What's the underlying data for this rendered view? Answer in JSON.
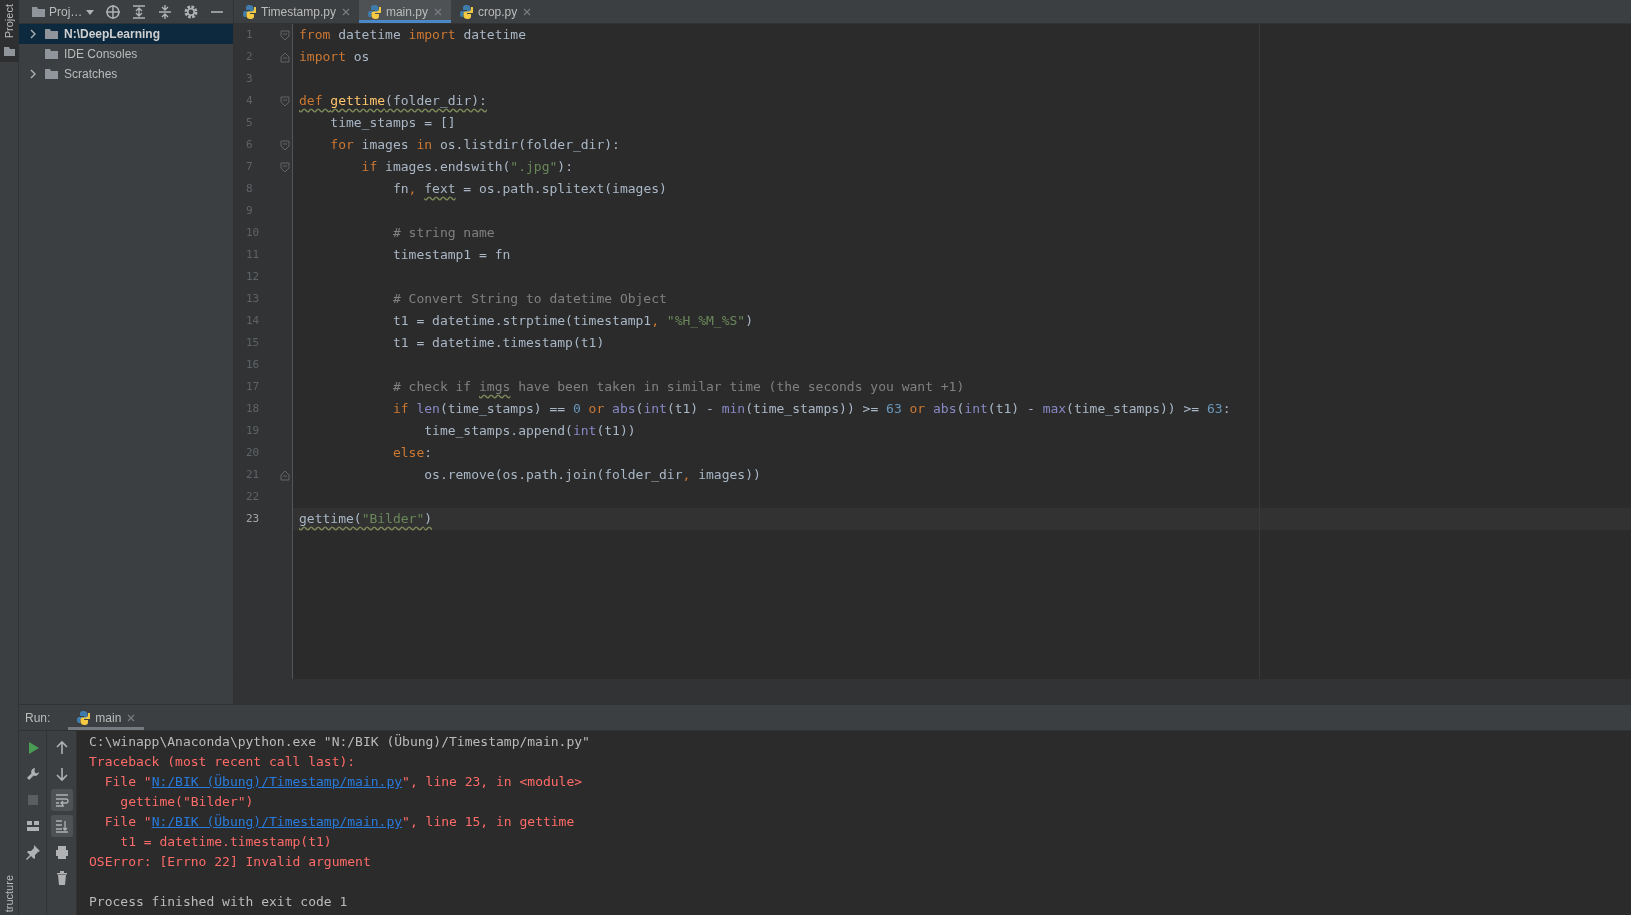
{
  "side_stripe": {
    "top_label": "Project",
    "bottom_label": "tructure"
  },
  "project_toolbar": {
    "title": "Proj…"
  },
  "project_tree": [
    {
      "label": "N:\\DeepLearning",
      "kind": "expandable",
      "expanded": false,
      "selected": true
    },
    {
      "label": "IDE Consoles",
      "kind": "plain",
      "selected": false
    },
    {
      "label": "Scratches",
      "kind": "expandable",
      "expanded": false,
      "selected": false
    }
  ],
  "tabs": [
    {
      "label": "Timestamp.py",
      "selected": false
    },
    {
      "label": "main.py",
      "selected": true
    },
    {
      "label": "crop.py",
      "selected": false
    }
  ],
  "editor": {
    "lines": [
      {
        "number": "1",
        "current": false,
        "fold": {
          "kind": "start"
        },
        "tokens": [
          {
            "t": "from ",
            "kind": "keyword"
          },
          {
            "t": "datetime "
          },
          {
            "t": "import ",
            "kind": "keyword"
          },
          {
            "t": "datetime"
          }
        ]
      },
      {
        "number": "2",
        "current": false,
        "fold": {
          "kind": "end"
        },
        "tokens": [
          {
            "t": "import ",
            "kind": "keyword"
          },
          {
            "t": "os"
          }
        ]
      },
      {
        "number": "3",
        "current": false
      },
      {
        "number": "4",
        "current": false,
        "fold": {
          "kind": "start"
        },
        "tokens": [
          {
            "t": "def ",
            "kind": "keyword",
            "warn": true
          },
          {
            "t": "gettime",
            "kind": "function",
            "warn": true
          },
          {
            "t": "(folder_dir):",
            "warn": true
          }
        ]
      },
      {
        "number": "5",
        "current": false,
        "tokens": [
          {
            "t": "    time_stamps = []"
          }
        ]
      },
      {
        "number": "6",
        "current": false,
        "fold": {
          "kind": "start"
        },
        "tokens": [
          {
            "t": "    for",
            "kind": "keyword"
          },
          {
            "t": " images "
          },
          {
            "t": "in",
            "kind": "keyword"
          },
          {
            "t": " os.listdir(folder_dir):"
          }
        ]
      },
      {
        "number": "7",
        "current": false,
        "fold": {
          "kind": "start"
        },
        "tokens": [
          {
            "t": "        if",
            "kind": "keyword"
          },
          {
            "t": " images.endswith("
          },
          {
            "t": "\".jpg\"",
            "kind": "string"
          },
          {
            "t": "):"
          }
        ]
      },
      {
        "number": "8",
        "current": false,
        "tokens": [
          {
            "t": "            fn"
          },
          {
            "t": ", ",
            "kind": "keyword"
          },
          {
            "t": "fext",
            "warn": true
          },
          {
            "t": " = os.path.splitext(images)"
          }
        ]
      },
      {
        "number": "9",
        "current": false
      },
      {
        "number": "10",
        "current": false,
        "tokens": [
          {
            "t": "            # string name",
            "kind": "comment"
          }
        ]
      },
      {
        "number": "11",
        "current": false,
        "tokens": [
          {
            "t": "            timestamp1 = fn"
          }
        ]
      },
      {
        "number": "12",
        "current": false
      },
      {
        "number": "13",
        "current": false,
        "tokens": [
          {
            "t": "            # Convert String to datetime Object",
            "kind": "comment"
          }
        ]
      },
      {
        "number": "14",
        "current": false,
        "tokens": [
          {
            "t": "            t1 = datetime.strptime(timestamp1"
          },
          {
            "t": ", ",
            "kind": "keyword"
          },
          {
            "t": "\"%H_%M_%S\"",
            "kind": "string"
          },
          {
            "t": ")"
          }
        ]
      },
      {
        "number": "15",
        "current": false,
        "tokens": [
          {
            "t": "            t1 = datetime.timestamp(t1)"
          }
        ]
      },
      {
        "number": "16",
        "current": false
      },
      {
        "number": "17",
        "current": false,
        "tokens": [
          {
            "t": "            # check if ",
            "kind": "comment"
          },
          {
            "t": "imgs",
            "kind": "comment",
            "warn": true
          },
          {
            "t": " have been taken in similar time (the seconds you want +1)",
            "kind": "comment"
          }
        ]
      },
      {
        "number": "18",
        "current": false,
        "tokens": [
          {
            "t": "            if ",
            "kind": "keyword"
          },
          {
            "t": "len",
            "kind": "builtin"
          },
          {
            "t": "(time_stamps) == "
          },
          {
            "t": "0",
            "kind": "number"
          },
          {
            "t": " or ",
            "kind": "keyword"
          },
          {
            "t": "abs",
            "kind": "builtin"
          },
          {
            "t": "("
          },
          {
            "t": "int",
            "kind": "builtin"
          },
          {
            "t": "(t1) - "
          },
          {
            "t": "min",
            "kind": "builtin"
          },
          {
            "t": "(time_stamps)) >= "
          },
          {
            "t": "63",
            "kind": "number"
          },
          {
            "t": " or ",
            "kind": "keyword"
          },
          {
            "t": "abs",
            "kind": "builtin"
          },
          {
            "t": "("
          },
          {
            "t": "int",
            "kind": "builtin"
          },
          {
            "t": "(t1) - "
          },
          {
            "t": "max",
            "kind": "builtin"
          },
          {
            "t": "(time_stamps)) >= "
          },
          {
            "t": "63",
            "kind": "number"
          },
          {
            "t": ":"
          }
        ]
      },
      {
        "number": "19",
        "current": false,
        "tokens": [
          {
            "t": "                time_stamps.append("
          },
          {
            "t": "int",
            "kind": "builtin"
          },
          {
            "t": "(t1))"
          }
        ]
      },
      {
        "number": "20",
        "current": false,
        "tokens": [
          {
            "t": "            else",
            "kind": "keyword"
          },
          {
            "t": ":"
          }
        ]
      },
      {
        "number": "21",
        "current": false,
        "fold": {
          "kind": "end"
        },
        "tokens": [
          {
            "t": "                os.remove(os.path.join(folder_dir"
          },
          {
            "t": ", ",
            "kind": "keyword"
          },
          {
            "t": "images))"
          }
        ]
      },
      {
        "number": "22",
        "current": false
      },
      {
        "number": "23",
        "current": true,
        "tokens": [
          {
            "t": "gettime(",
            "warn": true
          },
          {
            "t": "\"Bilder\"",
            "kind": "string",
            "warn": true
          },
          {
            "t": ")",
            "warn": true
          }
        ]
      }
    ]
  },
  "run_panel": {
    "label": "Run:",
    "tab": {
      "label": "main",
      "selected": true
    },
    "left_tools": [
      {
        "on": false
      },
      {
        "on": false
      },
      {
        "on": false
      },
      {
        "on": false
      },
      {
        "on": false
      }
    ],
    "right_tools": [
      {
        "on": false
      },
      {
        "on": false
      },
      {
        "on": true
      },
      {
        "on": true
      },
      {
        "on": false
      },
      {
        "on": false
      }
    ],
    "console": [
      {
        "kind": "normal",
        "parts": [
          {
            "t": "C:\\winapp\\Anaconda\\python.exe \"N:/BIK (Übung)/Timestamp/main.py\""
          }
        ]
      },
      {
        "kind": "error",
        "parts": [
          {
            "t": "Traceback (most recent call last):"
          }
        ]
      },
      {
        "kind": "error",
        "parts": [
          {
            "t": "  File \""
          },
          {
            "t": "N:/BIK (Übung)/Timestamp/main.py",
            "link": true
          },
          {
            "t": "\", line 23, in <module>"
          }
        ]
      },
      {
        "kind": "error",
        "parts": [
          {
            "t": "    gettime(\"Bilder\")"
          }
        ]
      },
      {
        "kind": "error",
        "parts": [
          {
            "t": "  File \""
          },
          {
            "t": "N:/BIK (Übung)/Timestamp/main.py",
            "link": true
          },
          {
            "t": "\", line 15, in gettime"
          }
        ]
      },
      {
        "kind": "error",
        "parts": [
          {
            "t": "    t1 = datetime.timestamp(t1)"
          }
        ]
      },
      {
        "kind": "error",
        "parts": [
          {
            "t": "OSError: [Errno 22] Invalid argument"
          }
        ]
      },
      {
        "kind": "blank"
      },
      {
        "kind": "normal",
        "parts": [
          {
            "t": "Process finished with exit code 1"
          }
        ]
      }
    ]
  }
}
